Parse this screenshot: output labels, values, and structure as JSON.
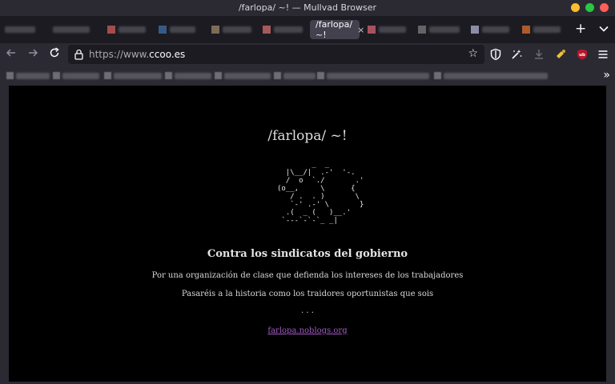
{
  "window": {
    "title": "/farlopa/ ~! — Mullvad Browser"
  },
  "tabs": {
    "active_label": "/farlopa/ ~!",
    "close_glyph": "×",
    "new_tab_glyph": "+",
    "list_glyph": "⌄"
  },
  "navbar": {
    "url_prefix": "https://www.",
    "url_domain": "ccoo.es"
  },
  "page": {
    "title": "/farlopa/ ~!",
    "ascii_art": "        _  _\n  |\\__/|  .-'  '-.\n  /  o  `./       .'\n(o__,     \\      {\n   / .  . )       \\\n   `-' .-' \\       }\n  .(  _ (   )__.'\n `---`-`-`_ _|",
    "heading": "Contra los sindicatos del gobierno",
    "line1": "Por una organización de clase que defienda los intereses de los trabajadores",
    "line2": "Pasaréis a la historia como los traidores oportunistas que sois",
    "ellipsis": ". . .",
    "link": "farlopa.noblogs.org"
  },
  "colors": {
    "chrome": "#2b2a33",
    "tabstrip": "#1c1b22",
    "link": "#a35cc5",
    "close": "#ff5f57",
    "minimize": "#febc2e",
    "zoom": "#28c840"
  }
}
